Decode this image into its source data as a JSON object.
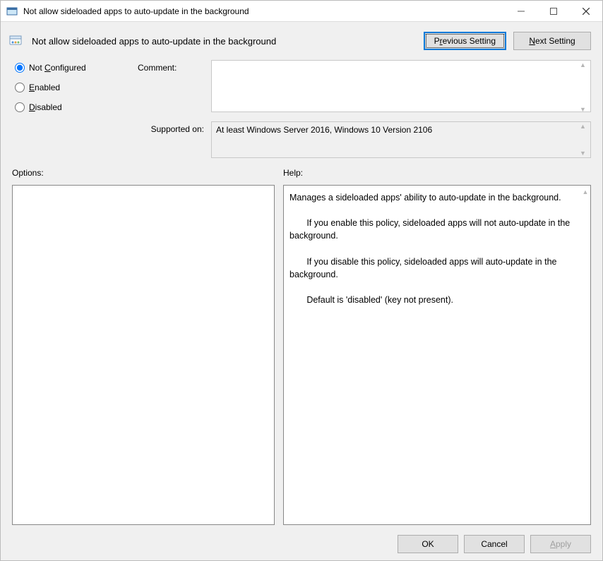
{
  "window": {
    "title": "Not allow sideloaded apps to auto-update in the background"
  },
  "header": {
    "title": "Not allow sideloaded apps to auto-update in the background",
    "prev_label_pre": "P",
    "prev_label_u": "r",
    "prev_label_post": "evious Setting",
    "next_label_pre": "",
    "next_label_u": "N",
    "next_label_post": "ext Setting"
  },
  "state": {
    "selected": "Not Configured",
    "not_configured_pre": "Not ",
    "not_configured_u": "C",
    "not_configured_post": "onfigured",
    "enabled_u": "E",
    "enabled_post": "nabled",
    "disabled_u": "D",
    "disabled_post": "isabled"
  },
  "labels": {
    "comment": "Comment:",
    "supported": "Supported on:",
    "options": "Options:",
    "help": "Help:"
  },
  "comment": "",
  "supported_on": "At least Windows Server 2016, Windows 10 Version 2106",
  "help_text": "Manages a sideloaded apps' ability to auto-update in the background.\n\n       If you enable this policy, sideloaded apps will not auto-update in the background.\n\n       If you disable this policy, sideloaded apps will auto-update in the background.\n\n       Default is 'disabled' (key not present).",
  "footer": {
    "ok": "OK",
    "cancel": "Cancel",
    "apply_pre": "",
    "apply_u": "A",
    "apply_post": "pply"
  }
}
